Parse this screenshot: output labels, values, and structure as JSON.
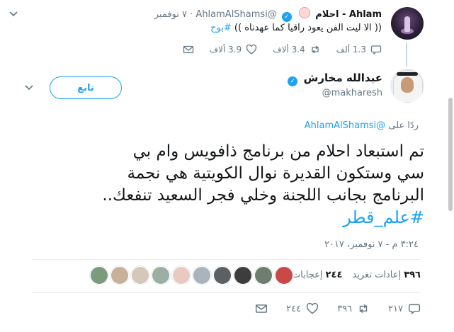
{
  "parent_tweet": {
    "name": "Ahlam - احلام",
    "handle": "@AhlamAlShamsi",
    "date": "٧ نوفمبر",
    "separator": "·",
    "text": "(( الا ليت الفن يعود راقيا كما عهدناه )) ",
    "hashtag": "#بوح",
    "reply_count": "1.3 ألف",
    "retweet_count": "3.4 ألاف",
    "like_count": "3.9 ألاف"
  },
  "main_tweet": {
    "name": "عبدالله مخارش",
    "handle": "@makharesh",
    "follow_label": "تابع",
    "replying_prefix": "ردًا على",
    "replying_to": "@AhlamAlShamsi",
    "text_lines": [
      "تم استبعاد احلام من برنامج ذافويس وام بي",
      "سي وستكون القديرة نوال الكويتية هي نجمة",
      "البرنامج بجانب اللجنة وخلي فجر السعيد تنفعك.."
    ],
    "hashtag": "#علم_قطر",
    "timestamp": "٣:٢٤ م - ٧ نوفمبر، ٢٠١٧",
    "retweets_stat_value": "٣٩٦",
    "retweets_stat_label": "إعادات تغريد",
    "likes_stat_value": "٢٤٤",
    "likes_stat_label": "إعجابات",
    "action_replies": "٢١٧",
    "action_retweets": "٣٩٦",
    "action_likes": "٢٤٤"
  },
  "likers": [
    {
      "color": "#7b9b7a"
    },
    {
      "color": "#c7b299"
    },
    {
      "color": "#d6c8b8"
    },
    {
      "color": "#9bb0a2"
    },
    {
      "color": "#eac9c0"
    },
    {
      "color": "#aab4bd"
    },
    {
      "color": "#5c5f63"
    },
    {
      "color": "#3d3d3d"
    },
    {
      "color": "#6e7d70"
    },
    {
      "color": "#c94848"
    }
  ],
  "icons": {
    "reply": "reply-icon",
    "retweet": "retweet-icon",
    "like": "heart-icon",
    "dm": "envelope-icon",
    "more": "chevron-down-icon",
    "verified": "verified-badge-icon"
  },
  "colors": {
    "accent": "#1da1f2",
    "muted": "#657786",
    "text": "#14171a"
  }
}
